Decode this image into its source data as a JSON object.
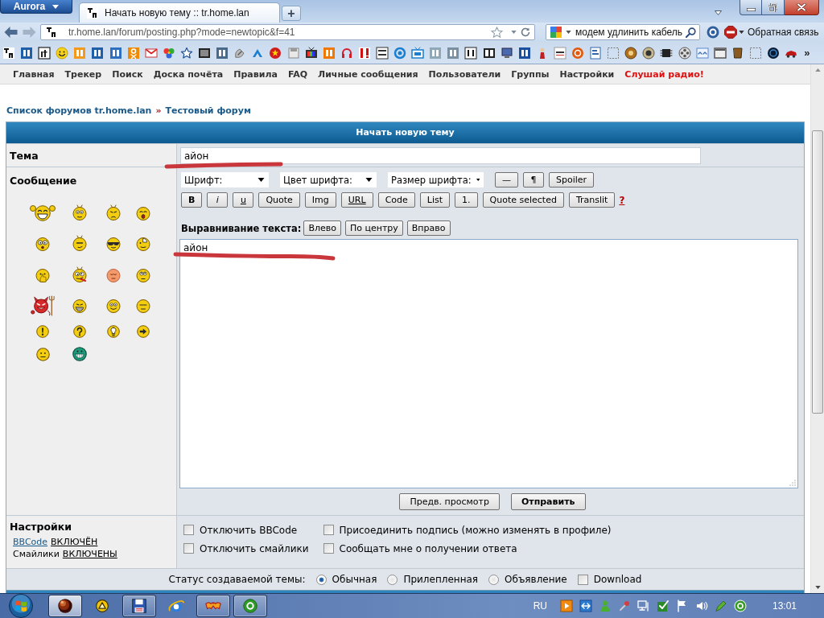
{
  "browser": {
    "app_menu": "Aurora",
    "tabs": [
      {
        "title": "Начать новую тему :: tr.home.lan",
        "selected": true
      }
    ],
    "new_tab": "+",
    "address": "tr.home.lan/forum/posting.php?mode=newtopic&f=41",
    "search": {
      "value": "модем удлинить кабель"
    },
    "feedback": "Обратная связь",
    "bookmarks_overflow": "»"
  },
  "forum_nav": [
    {
      "label": "Главная",
      "kind": "link"
    },
    {
      "label": "Трекер",
      "kind": "link"
    },
    {
      "label": "Поиск",
      "kind": "link"
    },
    {
      "label": "Доска почёта",
      "kind": "link"
    },
    {
      "label": "Правила",
      "kind": "link"
    },
    {
      "label": "FAQ",
      "kind": "link"
    },
    {
      "label": "Личные сообщения",
      "kind": "link"
    },
    {
      "label": "Пользователи",
      "kind": "link"
    },
    {
      "label": "Группы",
      "kind": "link"
    },
    {
      "label": "Настройки",
      "kind": "link"
    },
    {
      "label": "Слушай радио!",
      "kind": "highlight"
    }
  ],
  "breadcrumb": {
    "items": [
      "Список форумов tr.home.lan",
      "Тестовый форум"
    ],
    "separator": "»"
  },
  "form": {
    "title": "Начать новую тему",
    "subject": {
      "label": "Тема",
      "value": "айон"
    },
    "message": {
      "label": "Сообщение",
      "dropdowns": [
        {
          "value": "Шрифт:"
        },
        {
          "value": "Цвет шрифта:"
        },
        {
          "value": "Размер шрифта:"
        }
      ],
      "toolbar_top": [
        {
          "label": "—",
          "kind": "plain"
        },
        {
          "label": "¶",
          "kind": "plain"
        },
        {
          "label": "Spoiler",
          "kind": "plain"
        }
      ],
      "toolbar_bottom": [
        {
          "label": "B",
          "kind": "bold"
        },
        {
          "label": "i",
          "kind": "italic"
        },
        {
          "label": "u",
          "kind": "underline"
        },
        {
          "label": "Quote",
          "kind": "plain"
        },
        {
          "label": "Img",
          "kind": "plain"
        },
        {
          "label": "URL",
          "kind": "underline"
        },
        {
          "label": "Code",
          "kind": "plain"
        },
        {
          "label": "List",
          "kind": "plain"
        },
        {
          "label": "1.",
          "kind": "plain"
        },
        {
          "label": "Quote selected",
          "kind": "plain"
        },
        {
          "label": "Translit",
          "kind": "plain"
        }
      ],
      "help_link": "?",
      "alignment": {
        "label": "Выравнивание текста:",
        "buttons": [
          "Влево",
          "По центру",
          "Вправо"
        ]
      },
      "value": "айон",
      "actions": [
        {
          "label": "Предв. просмотр",
          "kind": "secondary"
        },
        {
          "label": "Отправить",
          "kind": "primary"
        }
      ]
    },
    "settings": {
      "label": "Настройки",
      "status": [
        {
          "kind": "link",
          "name": "BBCode",
          "value": "ВКЛЮЧЁН"
        },
        {
          "kind": "plain",
          "name": "Смайлики",
          "value": "ВКЛЮЧЕНЫ"
        }
      ],
      "options": [
        {
          "label": "Отключить BBCode",
          "checked": false
        },
        {
          "label": "Присоединить подпись (можно изменять в профиле)",
          "checked": false
        },
        {
          "label": "Отключить смайлики",
          "checked": false
        },
        {
          "label": "Сообщать мне о получении ответа",
          "checked": false
        }
      ]
    },
    "topic_status": {
      "label": "Статус создаваемой темы:",
      "types": [
        {
          "label": "Обычная",
          "selected": true
        },
        {
          "label": "Прилепленная",
          "selected": false
        },
        {
          "label": "Объявление",
          "selected": false
        }
      ],
      "download": {
        "label": "Download",
        "checked": false
      }
    }
  },
  "taskbar": {
    "apps": [
      {
        "running": true,
        "selected": true
      },
      {
        "running": false,
        "selected": false
      },
      {
        "running": true,
        "selected": false
      },
      {
        "running": false,
        "selected": false
      },
      {
        "running": true,
        "selected": false
      },
      {
        "running": true,
        "selected": false
      }
    ],
    "language": "RU",
    "clock": "13:01"
  }
}
